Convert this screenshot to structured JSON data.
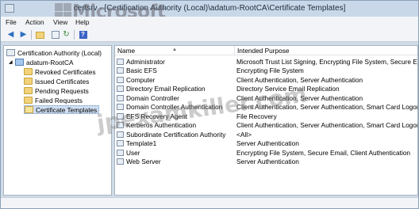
{
  "window": {
    "title": "certsrv - [Certification Authority (Local)\\adatum-RootCA\\Certificate Templates]"
  },
  "watermark": {
    "brand": "Microsoft",
    "site": "jpexamkiller.com"
  },
  "menu": [
    "File",
    "Action",
    "View",
    "Help"
  ],
  "toolbar": {
    "icons": [
      "back-arrow-icon",
      "forward-arrow-icon",
      "up-folder-icon",
      "export-list-icon",
      "refresh-icon",
      "help-icon"
    ]
  },
  "tree": {
    "root": "Certification Authority (Local)",
    "ca": "adatum-RootCA",
    "folders": [
      "Revoked Certificates",
      "Issued Certificates",
      "Pending Requests",
      "Failed Requests",
      "Certificate Templates"
    ],
    "selected": "Certificate Templates"
  },
  "list": {
    "columns": [
      "Name",
      "Intended Purpose"
    ],
    "rows": [
      {
        "name": "Administrator",
        "purpose": "Microsoft Trust List Signing, Encrypting File System, Secure Email, C"
      },
      {
        "name": "Basic EFS",
        "purpose": "Encrypting File System"
      },
      {
        "name": "Computer",
        "purpose": "Client Authentication, Server Authentication"
      },
      {
        "name": "Directory Email Replication",
        "purpose": "Directory Service Email Replication"
      },
      {
        "name": "Domain Controller",
        "purpose": "Client Authentication, Server Authentication"
      },
      {
        "name": "Domain Controller Authentication",
        "purpose": "Client Authentication, Server Authentication, Smart Card Logon"
      },
      {
        "name": "EFS Recovery Agent",
        "purpose": "File Recovery"
      },
      {
        "name": "Kerberos Authentication",
        "purpose": "Client Authentication, Server Authentication, Smart Card Logon, KD"
      },
      {
        "name": "Subordinate Certification Authority",
        "purpose": "<All>"
      },
      {
        "name": "Template1",
        "purpose": "Server Authentication"
      },
      {
        "name": "User",
        "purpose": "Encrypting File System, Secure Email, Client Authentication"
      },
      {
        "name": "Web Server",
        "purpose": "Server Authentication"
      }
    ]
  }
}
